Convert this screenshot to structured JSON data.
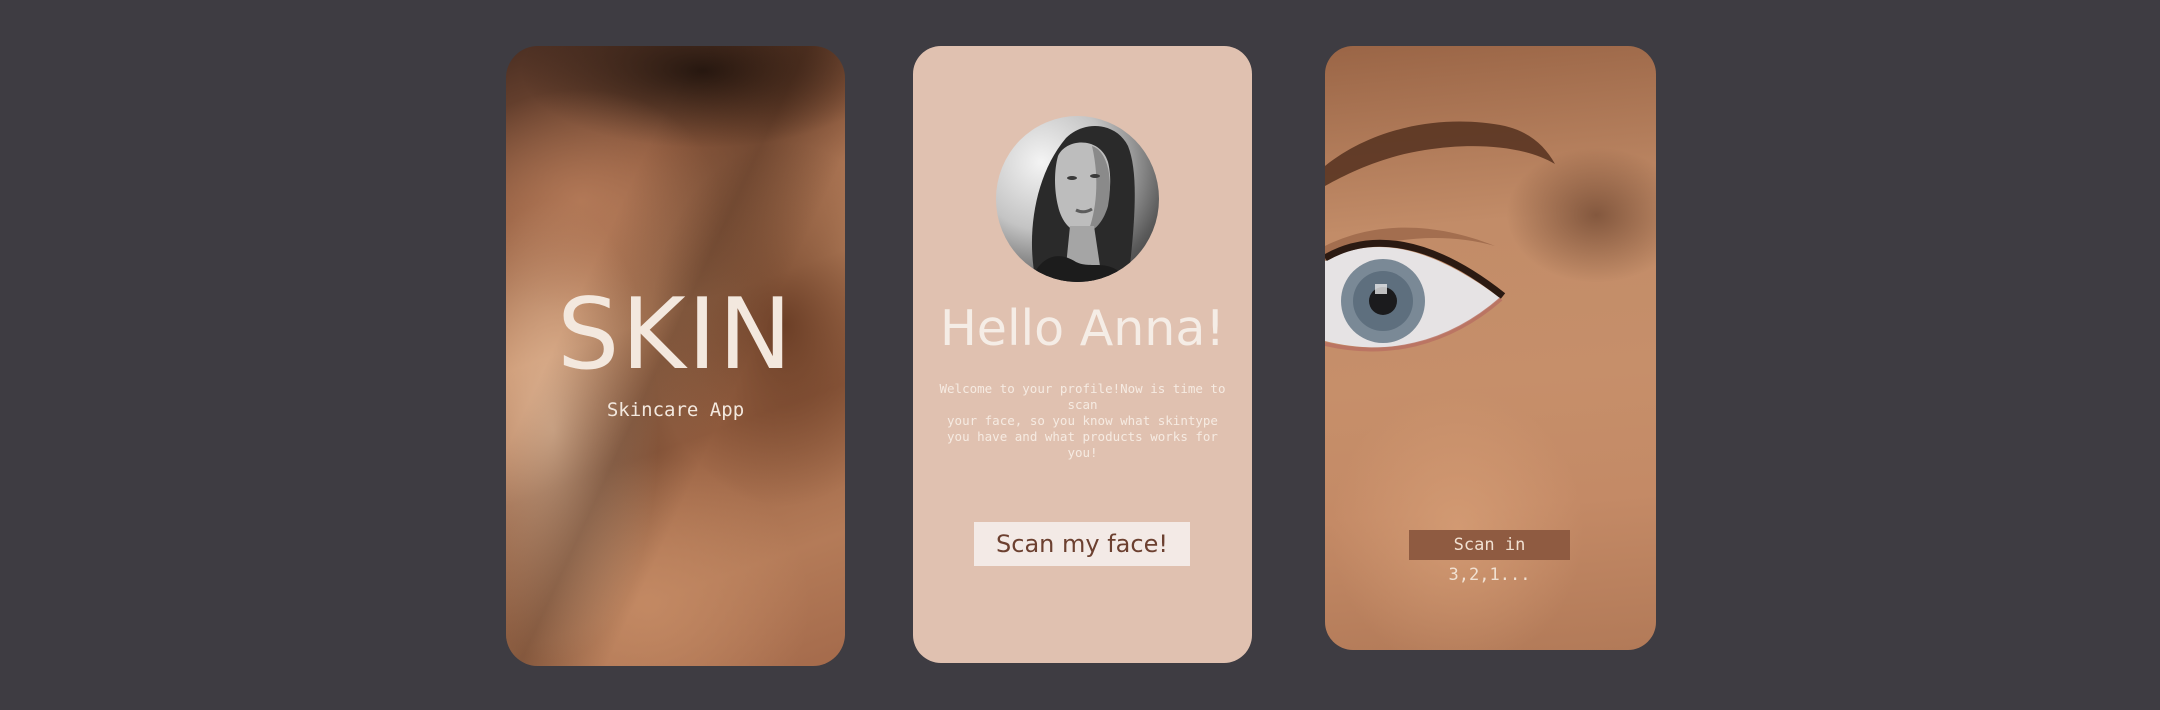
{
  "splash": {
    "logo": "SKIN",
    "subtitle": "Skincare App"
  },
  "profile": {
    "greeting": "Hello Anna!",
    "welcome_text": "Welcome to your profile!Now is time to scan\nyour face, so you know what skintype\nyou have and what products works for\nyou!",
    "scan_button": "Scan my face!"
  },
  "scan": {
    "countdown": "Scan in 3,2,1..."
  },
  "colors": {
    "background": "#3e3c42",
    "profile_card": "#e0c1b0",
    "button_bg": "#f3eae6",
    "button_text": "#6c4030",
    "countdown_bg": "#8f5b41",
    "light_text": "#f3e8de"
  }
}
